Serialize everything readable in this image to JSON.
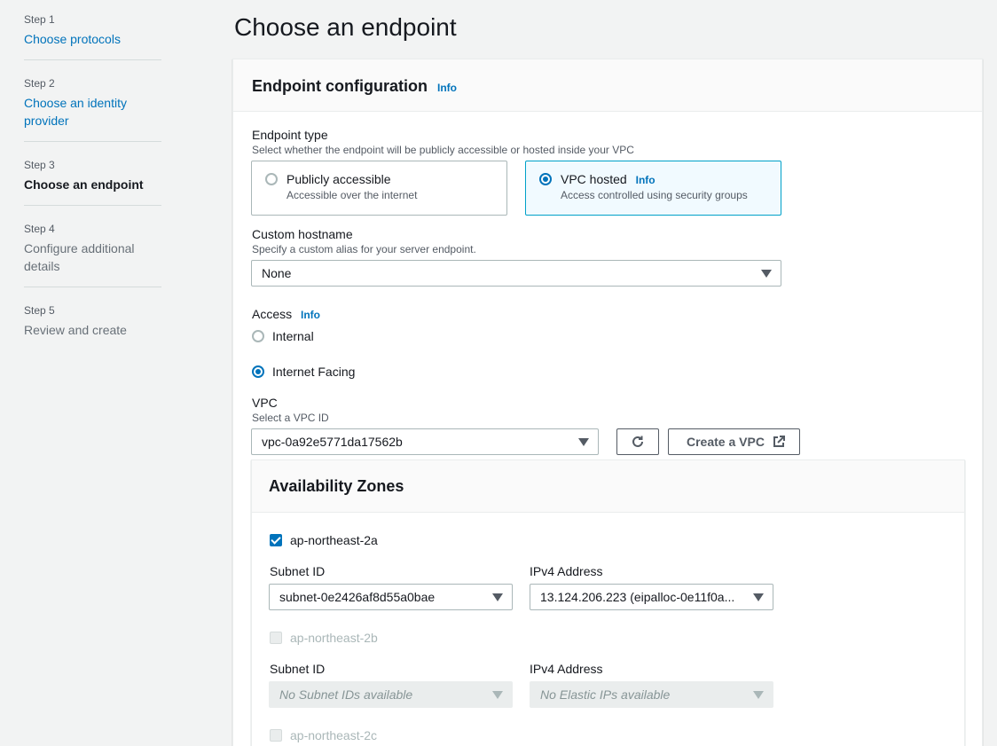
{
  "steps": [
    {
      "num": "Step 1",
      "label": "Choose protocols",
      "state": "link"
    },
    {
      "num": "Step 2",
      "label_line1": "Choose an identity",
      "label_line2": "provider",
      "state": "link"
    },
    {
      "num": "Step 3",
      "label": "Choose an endpoint",
      "state": "current"
    },
    {
      "num": "Step 4",
      "label_line1": "Configure additional",
      "label_line2": "details",
      "state": "disabled"
    },
    {
      "num": "Step 5",
      "label": "Review and create",
      "state": "disabled"
    }
  ],
  "page_title": "Choose an endpoint",
  "panel": {
    "title": "Endpoint configuration",
    "info": "Info"
  },
  "endpoint_type": {
    "label": "Endpoint type",
    "desc": "Select whether the endpoint will be publicly accessible or hosted inside your VPC",
    "options": [
      {
        "title": "Publicly accessible",
        "desc": "Accessible over the internet",
        "selected": false
      },
      {
        "title": "VPC hosted",
        "info": "Info",
        "desc": "Access controlled using security groups",
        "selected": true
      }
    ]
  },
  "custom_hostname": {
    "label": "Custom hostname",
    "desc": "Specify a custom alias for your server endpoint.",
    "value": "None"
  },
  "access": {
    "label": "Access",
    "info": "Info",
    "options": [
      {
        "label": "Internal",
        "selected": false
      },
      {
        "label": "Internet Facing",
        "selected": true
      }
    ]
  },
  "vpc": {
    "label": "VPC",
    "desc": "Select a VPC ID",
    "value": "vpc-0a92e5771da17562b",
    "create_label": "Create a VPC"
  },
  "availability_zones": {
    "title": "Availability Zones",
    "zones": [
      {
        "name": "ap-northeast-2a",
        "checked": true,
        "subnet_label": "Subnet ID",
        "subnet_value": "subnet-0e2426af8d55a0bae",
        "ipv4_label": "IPv4 Address",
        "ipv4_value": "13.124.206.223 (eipalloc-0e11f0a..."
      },
      {
        "name": "ap-northeast-2b",
        "checked": false,
        "subnet_label": "Subnet ID",
        "subnet_value": "No Subnet IDs available",
        "ipv4_label": "IPv4 Address",
        "ipv4_value": "No Elastic IPs available"
      },
      {
        "name": "ap-northeast-2c",
        "checked": false
      }
    ]
  },
  "colors": {
    "link": "#0073bb",
    "selected_border": "#00a1c9",
    "selected_bg": "#f1faff",
    "page_bg": "#f2f3f3"
  },
  "icons": [
    "refresh-icon",
    "external-link-icon",
    "caret-down-icon",
    "checkbox-check-icon"
  ]
}
